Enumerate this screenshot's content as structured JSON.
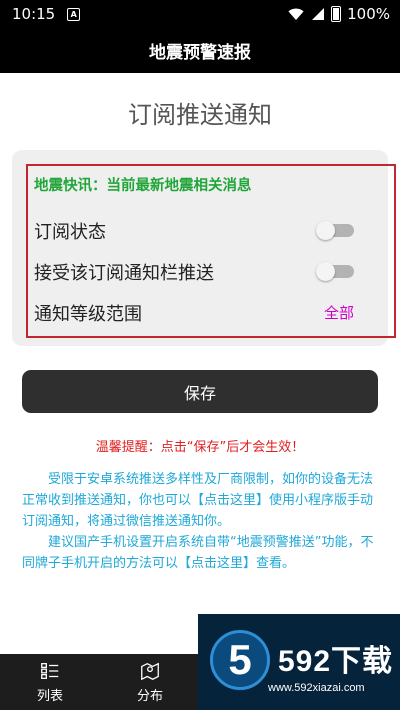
{
  "status_bar": {
    "time": "10:15",
    "battery": "100%"
  },
  "app_bar": {
    "title": "地震预警速报"
  },
  "page": {
    "title": "订阅推送通知"
  },
  "card": {
    "quick_news": "地震快讯：当前最新地震相关消息",
    "rows": [
      {
        "label": "订阅状态",
        "toggle_on": false
      },
      {
        "label": "接受该订阅通知栏推送",
        "toggle_on": false
      },
      {
        "label": "通知等级范围",
        "value": "全部"
      }
    ]
  },
  "actions": {
    "save_label": "保存"
  },
  "tip": "温馨提醒：点击“保存”后才会生效！",
  "paragraphs": [
    "受限于安卓系统推送多样性及厂商限制，如你的设备无法正常收到推送通知，你也可以【点击这里】使用小程序版手动订阅通知，将通过微信推送通知你。",
    "建议国产手机设置开启系统自带“地震预警推送”功能，不同牌子手机开启的方法可以【点击这里】查看。"
  ],
  "tabs": [
    {
      "label": "列表",
      "icon": "list-icon"
    },
    {
      "label": "分布",
      "icon": "map-pin-icon"
    }
  ],
  "watermark": {
    "logo": "5",
    "brand": "592下载",
    "url": "www.592xiazai.com"
  },
  "colors": {
    "quick_news": "#22a63a",
    "level_value": "#d000c8",
    "tip": "#e02020",
    "paragraph": "#1fa8d8",
    "highlight_border": "#c0282d"
  }
}
